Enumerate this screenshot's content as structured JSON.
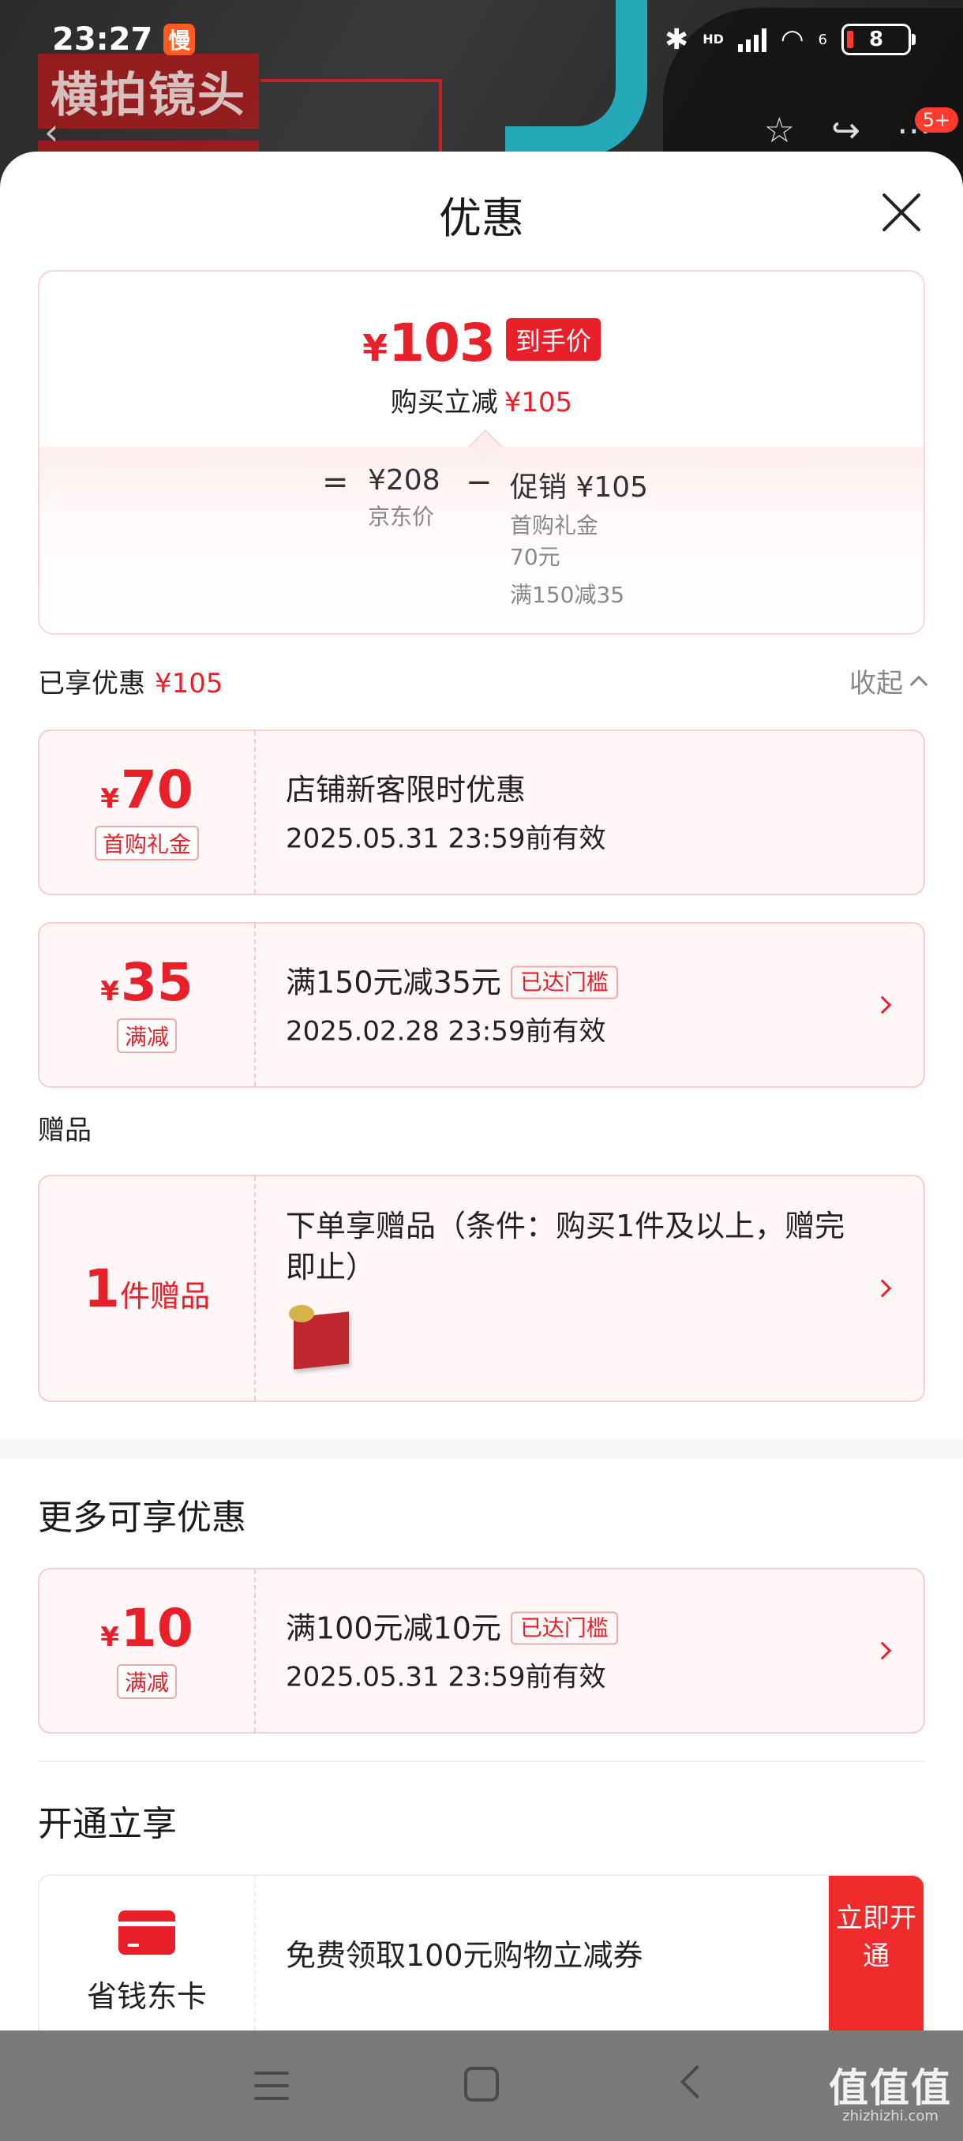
{
  "status_bar": {
    "time": "23:27",
    "app_badge": "慢",
    "hd_label": "HD",
    "network_label": "6",
    "battery": "8"
  },
  "backdrop": {
    "sign_text": "横拍镜头",
    "cart_count": "5+"
  },
  "sheet": {
    "title": "优惠"
  },
  "summary": {
    "final_price_symbol": "¥",
    "final_price": "103",
    "final_tag": "到手价",
    "reduce_label": "购买立减",
    "reduce_amount": "¥105",
    "eq": "=",
    "minus": "−",
    "jd_price": "¥208",
    "jd_price_label": "京东价",
    "promo_total": "促销 ¥105",
    "promo_items": [
      "首购礼金",
      "70元",
      "满150减35"
    ]
  },
  "enjoyed": {
    "label": "已享优惠",
    "amount": "¥105",
    "collapse_label": "收起"
  },
  "coupons": [
    {
      "symbol": "¥",
      "amount": "70",
      "tag": "首购礼金",
      "title": "店铺新客限时优惠",
      "badge": "",
      "date": "2025.05.31 23:59前有效"
    },
    {
      "symbol": "¥",
      "amount": "35",
      "tag": "满减",
      "title": "满150元减35元",
      "badge": "已达门槛",
      "date": "2025.02.28 23:59前有效"
    }
  ],
  "gift_section": {
    "label": "赠品",
    "count": "1",
    "count_suffix": "件赠品",
    "title": "下单享赠品（条件：购买1件及以上，赠完即止）"
  },
  "more": {
    "heading": "更多可享优惠",
    "coupon": {
      "symbol": "¥",
      "amount": "10",
      "tag": "满减",
      "title": "满100元减10元",
      "badge": "已达门槛",
      "date": "2025.05.31 23:59前有效"
    }
  },
  "open": {
    "heading": "开通立享",
    "card_name": "省钱东卡",
    "offer_text": "免费领取100元购物立减券",
    "button_label": "立即开通"
  },
  "watermark": {
    "main": "值值值",
    "sub": "zhizhizhi.com"
  },
  "colors": {
    "accent": "#e9202a",
    "coupon_bg": "#fff7f7"
  }
}
